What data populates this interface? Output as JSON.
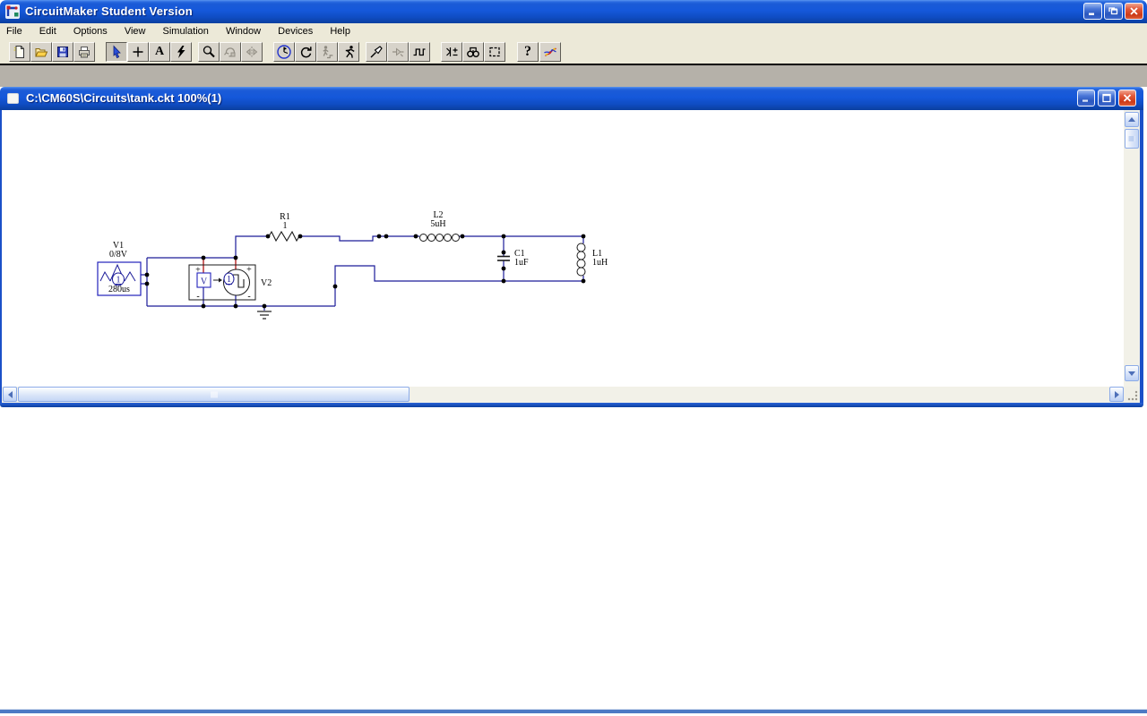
{
  "window": {
    "title": "CircuitMaker Student Version"
  },
  "menu": {
    "items": [
      "File",
      "Edit",
      "Options",
      "View",
      "Simulation",
      "Window",
      "Devices",
      "Help"
    ]
  },
  "toolbar": {
    "glyphs": {
      "text_tool": "A",
      "help": "?"
    },
    "icons": [
      "new-document-icon",
      "open-file-icon",
      "save-icon",
      "print-icon",
      "select-arrow-icon",
      "wire-plus-icon",
      "text-tool-icon",
      "delete-lightning-icon",
      "zoom-icon",
      "rotate-icon",
      "mirror-icon",
      "meter-icon",
      "reset-icon",
      "step-icon",
      "run-icon",
      "probe-icon",
      "probe-disabled-icon",
      "waveforms-icon",
      "device-params-icon",
      "search-binoculars-icon",
      "macro-icon",
      "help-icon",
      "mixed-mode-icon"
    ]
  },
  "document_window": {
    "title": "C:\\CM60S\\Circuits\\tank.ckt 100%(1)"
  },
  "circuit": {
    "v1": {
      "ref": "V1",
      "value": "0/8V",
      "param": "280us",
      "pin": "1"
    },
    "v2": {
      "ref": "V2",
      "source_letter": "V",
      "pin": "1",
      "plus": "+",
      "minus": "-"
    },
    "r1": {
      "ref": "R1",
      "value": "1"
    },
    "l2": {
      "ref": "L2",
      "value": "5uH"
    },
    "c1": {
      "ref": "C1",
      "value": "1uF"
    },
    "l1": {
      "ref": "L1",
      "value": "1uH"
    }
  },
  "colors": {
    "wire": "#1c1c99",
    "pin_red": "#aa0000",
    "component_blue": "#2222bb",
    "titlebar_blue": "#1558da",
    "toolbar_beige": "#ece9d8"
  }
}
